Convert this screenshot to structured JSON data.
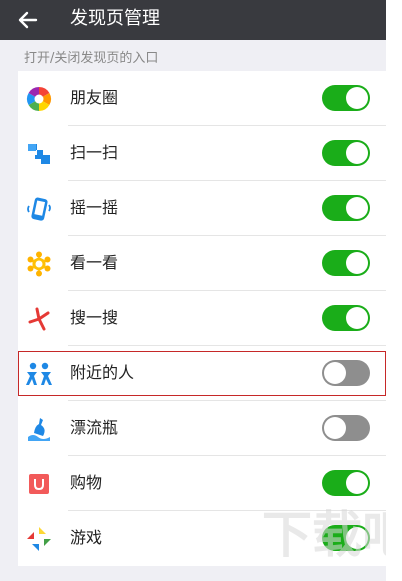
{
  "header": {
    "title": "发现页管理"
  },
  "section": {
    "header": "打开/关闭发现页的入口"
  },
  "items": [
    {
      "label": "朋友圈",
      "icon": "moments-icon",
      "on": true
    },
    {
      "label": "扫一扫",
      "icon": "scan-icon",
      "on": true
    },
    {
      "label": "摇一摇",
      "icon": "shake-icon",
      "on": true
    },
    {
      "label": "看一看",
      "icon": "top-stories-icon",
      "on": true
    },
    {
      "label": "搜一搜",
      "icon": "search-icon",
      "on": true
    },
    {
      "label": "附近的人",
      "icon": "people-nearby-icon",
      "on": false
    },
    {
      "label": "漂流瓶",
      "icon": "drift-bottle-icon",
      "on": false
    },
    {
      "label": "购物",
      "icon": "shopping-icon",
      "on": true
    },
    {
      "label": "游戏",
      "icon": "games-icon",
      "on": true
    }
  ],
  "colors": {
    "toggle_on": "#1aad19",
    "toggle_off": "#8e8e8e",
    "titlebar": "#393a3f",
    "highlight": "#c62828"
  }
}
